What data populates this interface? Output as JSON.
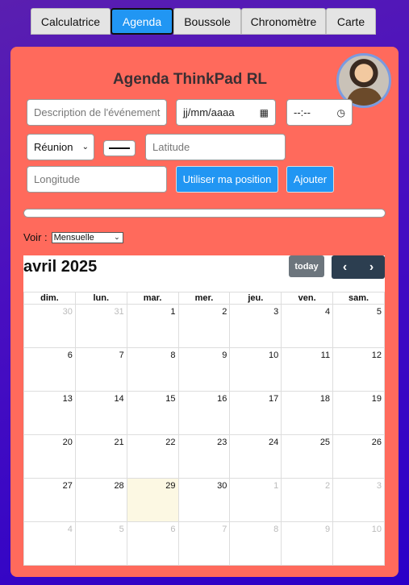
{
  "tabs": [
    {
      "label": "Calculatrice",
      "active": false
    },
    {
      "label": "Agenda",
      "active": true
    },
    {
      "label": "Boussole",
      "active": false
    },
    {
      "label": "Chronomètre",
      "active": false
    },
    {
      "label": "Carte",
      "active": false
    }
  ],
  "header": {
    "title": "Agenda ThinkPad RL"
  },
  "form": {
    "description_placeholder": "Description de l'événement",
    "date_placeholder": "jj/mm/aaaa",
    "time_placeholder": "--:--",
    "type_value": "Réunion",
    "latitude_placeholder": "Latitude",
    "longitude_placeholder": "Longitude",
    "use_position_label": "Utiliser ma position",
    "add_label": "Ajouter"
  },
  "view": {
    "label": "Voir :",
    "selected": "Mensuelle"
  },
  "calendar": {
    "month_title": "avril 2025",
    "today_label": "today",
    "prev_icon": "‹",
    "next_icon": "›",
    "weekdays": [
      "dim.",
      "lun.",
      "mar.",
      "mer.",
      "jeu.",
      "ven.",
      "sam."
    ],
    "weeks": [
      [
        {
          "d": "30",
          "o": true
        },
        {
          "d": "31",
          "o": true
        },
        {
          "d": "1"
        },
        {
          "d": "2"
        },
        {
          "d": "3"
        },
        {
          "d": "4"
        },
        {
          "d": "5"
        }
      ],
      [
        {
          "d": "6"
        },
        {
          "d": "7"
        },
        {
          "d": "8"
        },
        {
          "d": "9"
        },
        {
          "d": "10"
        },
        {
          "d": "11"
        },
        {
          "d": "12"
        }
      ],
      [
        {
          "d": "13"
        },
        {
          "d": "14"
        },
        {
          "d": "15"
        },
        {
          "d": "16"
        },
        {
          "d": "17"
        },
        {
          "d": "18"
        },
        {
          "d": "19"
        }
      ],
      [
        {
          "d": "20"
        },
        {
          "d": "21"
        },
        {
          "d": "22"
        },
        {
          "d": "23"
        },
        {
          "d": "24"
        },
        {
          "d": "25"
        },
        {
          "d": "26"
        }
      ],
      [
        {
          "d": "27"
        },
        {
          "d": "28"
        },
        {
          "d": "29",
          "today": true
        },
        {
          "d": "30"
        },
        {
          "d": "1",
          "o": true
        },
        {
          "d": "2",
          "o": true
        },
        {
          "d": "3",
          "o": true
        }
      ],
      [
        {
          "d": "4",
          "o": true
        },
        {
          "d": "5",
          "o": true
        },
        {
          "d": "6",
          "o": true
        },
        {
          "d": "7",
          "o": true
        },
        {
          "d": "8",
          "o": true
        },
        {
          "d": "9",
          "o": true
        },
        {
          "d": "10",
          "o": true
        }
      ]
    ]
  },
  "colors": {
    "accent": "#2196f3",
    "panel": "#ff6a5c",
    "today_bg": "#fcf8e3"
  }
}
